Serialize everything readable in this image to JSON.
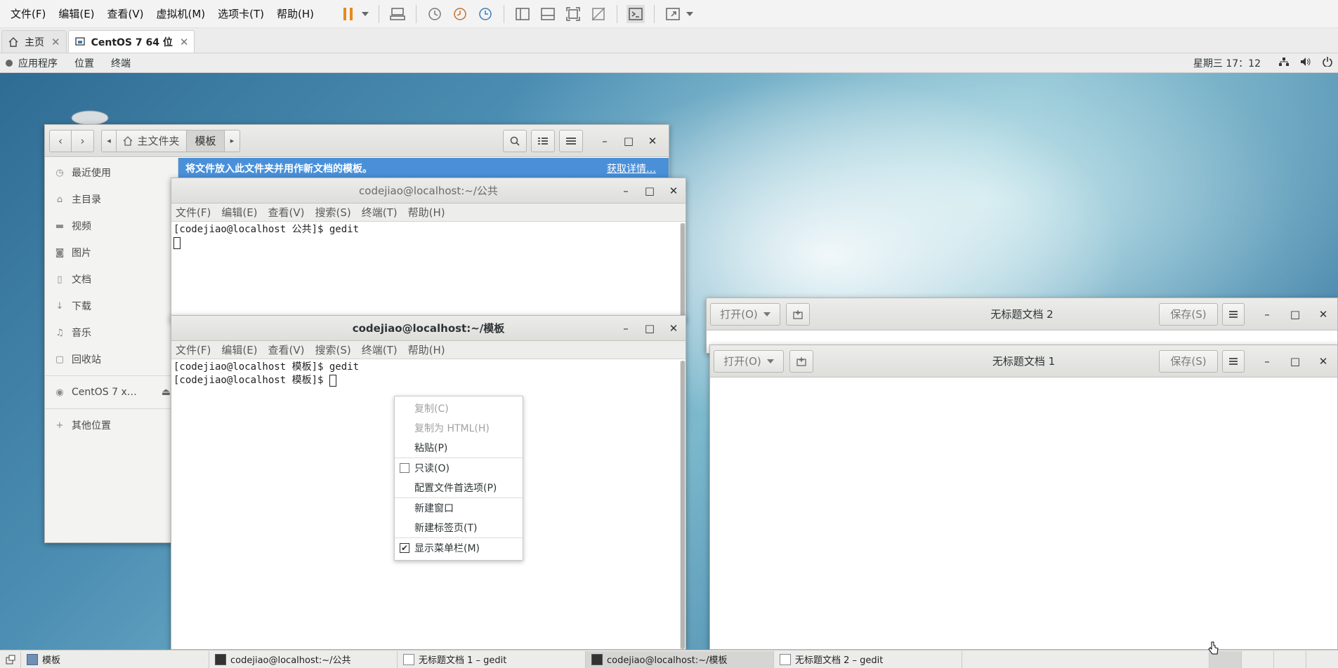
{
  "vm_menu": [
    "文件(F)",
    "编辑(E)",
    "查看(V)",
    "虚拟机(M)",
    "选项卡(T)",
    "帮助(H)"
  ],
  "vm_tabs": [
    {
      "label": "主页",
      "close": "✕"
    },
    {
      "label": "CentOS 7 64 位",
      "close": "✕"
    }
  ],
  "gnome": {
    "apps": "应用程序",
    "places": "位置",
    "terminal": "终端",
    "clock": "星期三 17：12"
  },
  "file_manager": {
    "path_home": "主文件夹",
    "path_current": "模板",
    "banner_text": "将文件放入此文件夹并用作新文档的模板。",
    "banner_link": "获取详情…",
    "sidebar": [
      {
        "label": "最近使用",
        "icon": "clock-icon"
      },
      {
        "label": "主目录",
        "icon": "home-icon"
      },
      {
        "label": "视频",
        "icon": "video-icon"
      },
      {
        "label": "图片",
        "icon": "camera-icon"
      },
      {
        "label": "文档",
        "icon": "document-icon"
      },
      {
        "label": "下载",
        "icon": "download-icon"
      },
      {
        "label": "音乐",
        "icon": "music-icon"
      },
      {
        "label": "回收站",
        "icon": "trash-icon"
      },
      {
        "label": "CentOS 7 x…",
        "icon": "disc-icon"
      },
      {
        "label": "其他位置",
        "icon": "plus-icon"
      }
    ]
  },
  "term1": {
    "title": "codejiao@localhost:~/公共",
    "menu": [
      "文件(F)",
      "编辑(E)",
      "查看(V)",
      "搜索(S)",
      "终端(T)",
      "帮助(H)"
    ],
    "lines": [
      "[codejiao@localhost 公共]$ gedit"
    ]
  },
  "term2": {
    "title": "codejiao@localhost:~/模板",
    "menu": [
      "文件(F)",
      "编辑(E)",
      "查看(V)",
      "搜索(S)",
      "终端(T)",
      "帮助(H)"
    ],
    "lines": [
      "[codejiao@localhost 模板]$ gedit",
      "[codejiao@localhost 模板]$ "
    ]
  },
  "context_menu": {
    "copy": "复制(C)",
    "copy_html": "复制为 HTML(H)",
    "paste": "粘贴(P)",
    "readonly": "只读(O)",
    "profile_prefs": "配置文件首选项(P)",
    "new_window": "新建窗口",
    "new_tab": "新建标签页(T)",
    "show_menubar": "显示菜单栏(M)"
  },
  "gedit2": {
    "title": "无标题文档 2",
    "open": "打开(O)",
    "save": "保存(S)"
  },
  "gedit1": {
    "title": "无标题文档 1",
    "open": "打开(O)",
    "save": "保存(S)"
  },
  "taskbar": [
    {
      "label": "模板"
    },
    {
      "label": "codejiao@localhost:~/公共"
    },
    {
      "label": "无标题文档 1 – gedit"
    },
    {
      "label": "codejiao@localhost:~/模板"
    },
    {
      "label": "无标题文档 2 – gedit"
    }
  ],
  "colors": {
    "selection_blue": "#4a90d9",
    "terminal_text": "#222222"
  }
}
